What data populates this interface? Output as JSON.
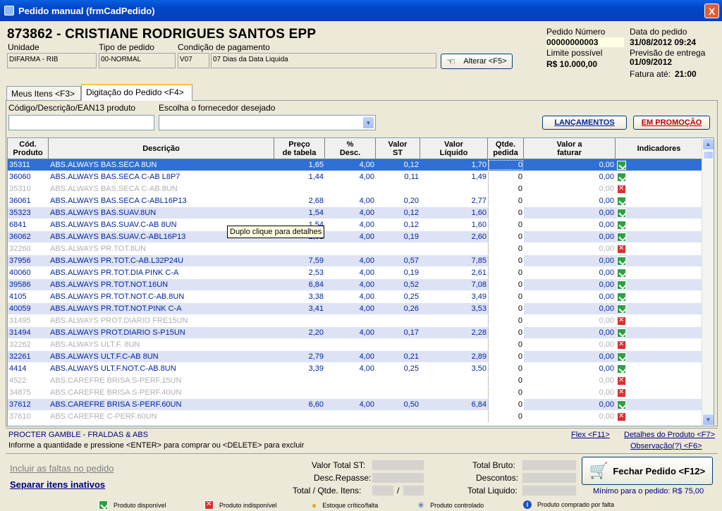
{
  "window": {
    "title": "Pedido manual (frmCadPedido)",
    "close": "X"
  },
  "header": {
    "client": "873862 - CRISTIANE RODRIGUES SANTOS EPP",
    "unidade_label": "Unidade",
    "unidade": "DIFARMA - RIB",
    "tipo_label": "Tipo de pedido",
    "tipo": "00-NORMAL",
    "condicao_label": "Condição de pagamento",
    "condicao_code": "V07",
    "condicao": "07 Dias da Data Liquida",
    "alterar": "Alterar <F5>",
    "pedido_numero_label": "Pedido Número",
    "pedido_numero": "00000000003",
    "limite_label": "Limite possível",
    "limite": "R$ 10.000,00",
    "data_label": "Data do pedido",
    "data": "31/08/2012 09:24",
    "previsao_label": "Previsão de entrega",
    "previsao": "01/09/2012",
    "fatura_label": "Fatura até:",
    "fatura": "21:00"
  },
  "tabs": [
    "Meus Itens <F3>",
    "Digitação do Pedido <F4>"
  ],
  "search": {
    "produto_label": "Código/Descrição/EAN13 produto",
    "fornecedor_label": "Escolha o fornecedor desejado",
    "lancamentos": "LANÇAMENTOS",
    "promocao": "EM PROMOÇÃO"
  },
  "columns": [
    "Cód.\nProduto",
    "Descrição",
    "Preço\nde tabela",
    "%\nDesc.",
    "Valor\nST",
    "Valor\nLíquido",
    "Qtde.\npedida",
    "Valor a\nfaturar",
    "Indicadores"
  ],
  "rows": [
    {
      "cod": "35311",
      "desc": "ABS.ALWAYS BAS.SECA 8UN",
      "preco": "1,65",
      "desc_pct": "4,00",
      "st": "0,12",
      "liq": "1,70",
      "qtd": "0",
      "fat": "0,00",
      "status": "ok",
      "style": "sel"
    },
    {
      "cod": "36060",
      "desc": "ABS.ALWAYS BAS.SECA C-AB L8P7",
      "preco": "1,44",
      "desc_pct": "4,00",
      "st": "0,11",
      "liq": "1,49",
      "qtd": "0",
      "fat": "0,00",
      "status": "ok",
      "style": "std"
    },
    {
      "cod": "35310",
      "desc": "ABS.ALWAYS BAS.SECA C-AB.8UN",
      "preco": "",
      "desc_pct": "",
      "st": "",
      "liq": "",
      "qtd": "0",
      "fat": "0,00",
      "status": "no",
      "style": "inact"
    },
    {
      "cod": "36061",
      "desc": "ABS.ALWAYS BAS.SECA C-ABL16P13",
      "preco": "2,68",
      "desc_pct": "4,00",
      "st": "0,20",
      "liq": "2,77",
      "qtd": "0",
      "fat": "0,00",
      "status": "ok",
      "style": "std"
    },
    {
      "cod": "35323",
      "desc": "ABS.ALWAYS BAS.SUAV.8UN",
      "preco": "1,54",
      "desc_pct": "4,00",
      "st": "0,12",
      "liq": "1,60",
      "qtd": "0",
      "fat": "0,00",
      "status": "ok",
      "style": "alt"
    },
    {
      "cod": "6841",
      "desc": "ABS.ALWAYS BAS.SUAV.C-AB 8UN",
      "preco": "1,54",
      "desc_pct": "4,00",
      "st": "0,12",
      "liq": "1,60",
      "qtd": "0",
      "fat": "0,00",
      "status": "ok",
      "style": "std"
    },
    {
      "cod": "36062",
      "desc": "ABS.ALWAYS BAS.SUAV.C-ABL16P13",
      "preco": "2,51",
      "desc_pct": "4,00",
      "st": "0,19",
      "liq": "2,60",
      "qtd": "0",
      "fat": "0,00",
      "status": "ok",
      "style": "alt"
    },
    {
      "cod": "32260",
      "desc": "ABS.ALWAYS PR.TOT.8UN",
      "preco": "",
      "desc_pct": "",
      "st": "",
      "liq": "",
      "qtd": "0",
      "fat": "0,00",
      "status": "no",
      "style": "inact"
    },
    {
      "cod": "37956",
      "desc": "ABS.ALWAYS PR.TOT.C-AB.L32P24U",
      "preco": "7,59",
      "desc_pct": "4,00",
      "st": "0,57",
      "liq": "7,85",
      "qtd": "0",
      "fat": "0,00",
      "status": "ok",
      "style": "alt"
    },
    {
      "cod": "40060",
      "desc": "ABS.ALWAYS PR.TOT.DIA PINK C-A",
      "preco": "2,53",
      "desc_pct": "4,00",
      "st": "0,19",
      "liq": "2,61",
      "qtd": "0",
      "fat": "0,00",
      "status": "ok",
      "style": "std"
    },
    {
      "cod": "39586",
      "desc": "ABS.ALWAYS PR.TOT.NOT.16UN",
      "preco": "6,84",
      "desc_pct": "4,00",
      "st": "0,52",
      "liq": "7,08",
      "qtd": "0",
      "fat": "0,00",
      "status": "ok",
      "style": "alt"
    },
    {
      "cod": "4105",
      "desc": "ABS.ALWAYS PR.TOT.NOT.C-AB.8UN",
      "preco": "3,38",
      "desc_pct": "4,00",
      "st": "0,25",
      "liq": "3,49",
      "qtd": "0",
      "fat": "0,00",
      "status": "ok",
      "style": "std"
    },
    {
      "cod": "40059",
      "desc": "ABS.ALWAYS PR.TOT.NOT.PINK C-A",
      "preco": "3,41",
      "desc_pct": "4,00",
      "st": "0,26",
      "liq": "3,53",
      "qtd": "0",
      "fat": "0,00",
      "status": "ok",
      "style": "alt"
    },
    {
      "cod": "31495",
      "desc": "ABS.ALWAYS PROT.DIARIO FRE15UN",
      "preco": "",
      "desc_pct": "",
      "st": "",
      "liq": "",
      "qtd": "0",
      "fat": "0,00",
      "status": "no",
      "style": "inact"
    },
    {
      "cod": "31494",
      "desc": "ABS.ALWAYS PROT.DIARIO S-P15UN",
      "preco": "2,20",
      "desc_pct": "4,00",
      "st": "0,17",
      "liq": "2,28",
      "qtd": "0",
      "fat": "0,00",
      "status": "ok",
      "style": "alt"
    },
    {
      "cod": "32262",
      "desc": "ABS.ALWAYS ULT.F. 8UN",
      "preco": "",
      "desc_pct": "",
      "st": "",
      "liq": "",
      "qtd": "0",
      "fat": "0,00",
      "status": "no",
      "style": "inact"
    },
    {
      "cod": "32261",
      "desc": "ABS.ALWAYS ULT.F.C-AB 8UN",
      "preco": "2,79",
      "desc_pct": "4,00",
      "st": "0,21",
      "liq": "2,89",
      "qtd": "0",
      "fat": "0,00",
      "status": "ok",
      "style": "alt"
    },
    {
      "cod": "4414",
      "desc": "ABS.ALWAYS ULT.F.NOT.C-AB.8UN",
      "preco": "3,39",
      "desc_pct": "4,00",
      "st": "0,25",
      "liq": "3,50",
      "qtd": "0",
      "fat": "0,00",
      "status": "ok",
      "style": "std"
    },
    {
      "cod": "4522",
      "desc": "ABS.CAREFRE BRISA S-PERF.15UN",
      "preco": "",
      "desc_pct": "",
      "st": "",
      "liq": "",
      "qtd": "0",
      "fat": "0,00",
      "status": "no",
      "style": "inact"
    },
    {
      "cod": "34875",
      "desc": "ABS.CAREFRE BRISA S-PERF.40UN",
      "preco": "",
      "desc_pct": "",
      "st": "",
      "liq": "",
      "qtd": "0",
      "fat": "0,00",
      "status": "no",
      "style": "inact"
    },
    {
      "cod": "37612",
      "desc": "ABS.CAREFRE BRISA S-PERF.60UN",
      "preco": "6,60",
      "desc_pct": "4,00",
      "st": "0,50",
      "liq": "6,84",
      "qtd": "0",
      "fat": "0,00",
      "status": "ok",
      "style": "alt"
    },
    {
      "cod": "37610",
      "desc": "ABS.CAREFRE C-PERF.60UN",
      "preco": "",
      "desc_pct": "",
      "st": "",
      "liq": "",
      "qtd": "0",
      "fat": "0,00",
      "status": "no",
      "style": "inact"
    }
  ],
  "tooltip": "Duplo clique para detalhes",
  "footer": {
    "fornecedor": "PROCTER GAMBLE - FRALDAS & ABS",
    "instrucao": "Informe a quantidade e pressione <ENTER> para comprar ou <DELETE> para excluir",
    "flex": "Flex <F11>",
    "detalhes": "Detalhes do Produto <F7>",
    "observacao": "Observação(?) <F6>",
    "incluir_faltas": "Incluir as faltas no pedido",
    "separar": "Separar itens inativos",
    "valor_st": "Valor Total ST:",
    "desc_repasse": "Desc.Repasse:",
    "total_itens": "Total / Qtde. Itens:",
    "slash": "/",
    "total_bruto": "Total Bruto:",
    "descontos": "Descontos:",
    "total_liquido": "Total Liquido:",
    "fechar": "Fechar Pedido <F12>",
    "minimo": "Mínimo para o pedido: R$ 75,00"
  },
  "legend": [
    "Produto disponível",
    "Produto indisponível",
    "Estoque crítico/falta",
    "Produto controlado",
    "Produto comprado por falta"
  ]
}
